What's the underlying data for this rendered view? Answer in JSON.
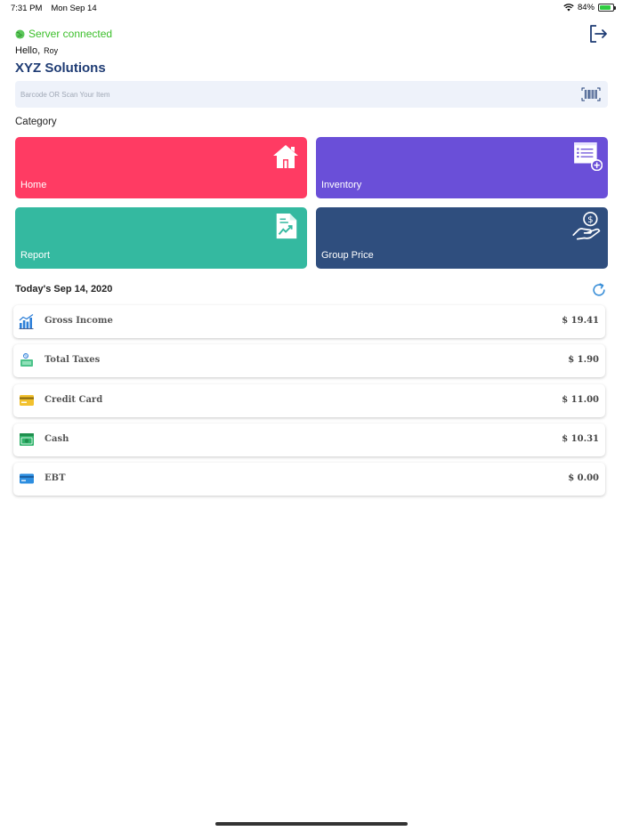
{
  "status_bar": {
    "time": "7:31 PM",
    "date": "Mon Sep 14",
    "battery": "84%",
    "battery_level": 0.84
  },
  "header": {
    "server_status": "Server connected",
    "greeting": "Hello,",
    "user_name": "Roy",
    "company": "XYZ Solutions",
    "logout_icon": "logout-icon"
  },
  "search": {
    "placeholder": "Barcode OR Scan Your Item",
    "value": "",
    "icon": "barcode-icon"
  },
  "category": {
    "title": "Category",
    "tiles": [
      {
        "label": "Home",
        "color": "#ff3b63",
        "icon": "house-icon"
      },
      {
        "label": "Inventory",
        "color": "#6a4fd8",
        "icon": "inventory-add-icon"
      },
      {
        "label": "Report",
        "color": "#34b9a0",
        "icon": "report-chart-icon"
      },
      {
        "label": "Group Price",
        "color": "#2f4e7e",
        "icon": "hand-dollar-icon"
      }
    ]
  },
  "summary": {
    "title": "Today's Sep 14, 2020",
    "refresh_icon": "refresh-icon",
    "items": [
      {
        "label": "Gross Income",
        "value": "$ 19.41",
        "icon": "bar-chart-icon"
      },
      {
        "label": "Total Taxes",
        "value": "$ 1.90",
        "icon": "tax-icon"
      },
      {
        "label": "Credit Card",
        "value": "$ 11.00",
        "icon": "credit-card-icon"
      },
      {
        "label": "Cash",
        "value": "$ 10.31",
        "icon": "cash-icon"
      },
      {
        "label": "EBT",
        "value": "$ 0.00",
        "icon": "ebt-card-icon"
      }
    ]
  },
  "colors": {
    "accent": "#1f3c74",
    "server_ok": "#3bbf2a",
    "refresh": "#3a8fd8"
  }
}
